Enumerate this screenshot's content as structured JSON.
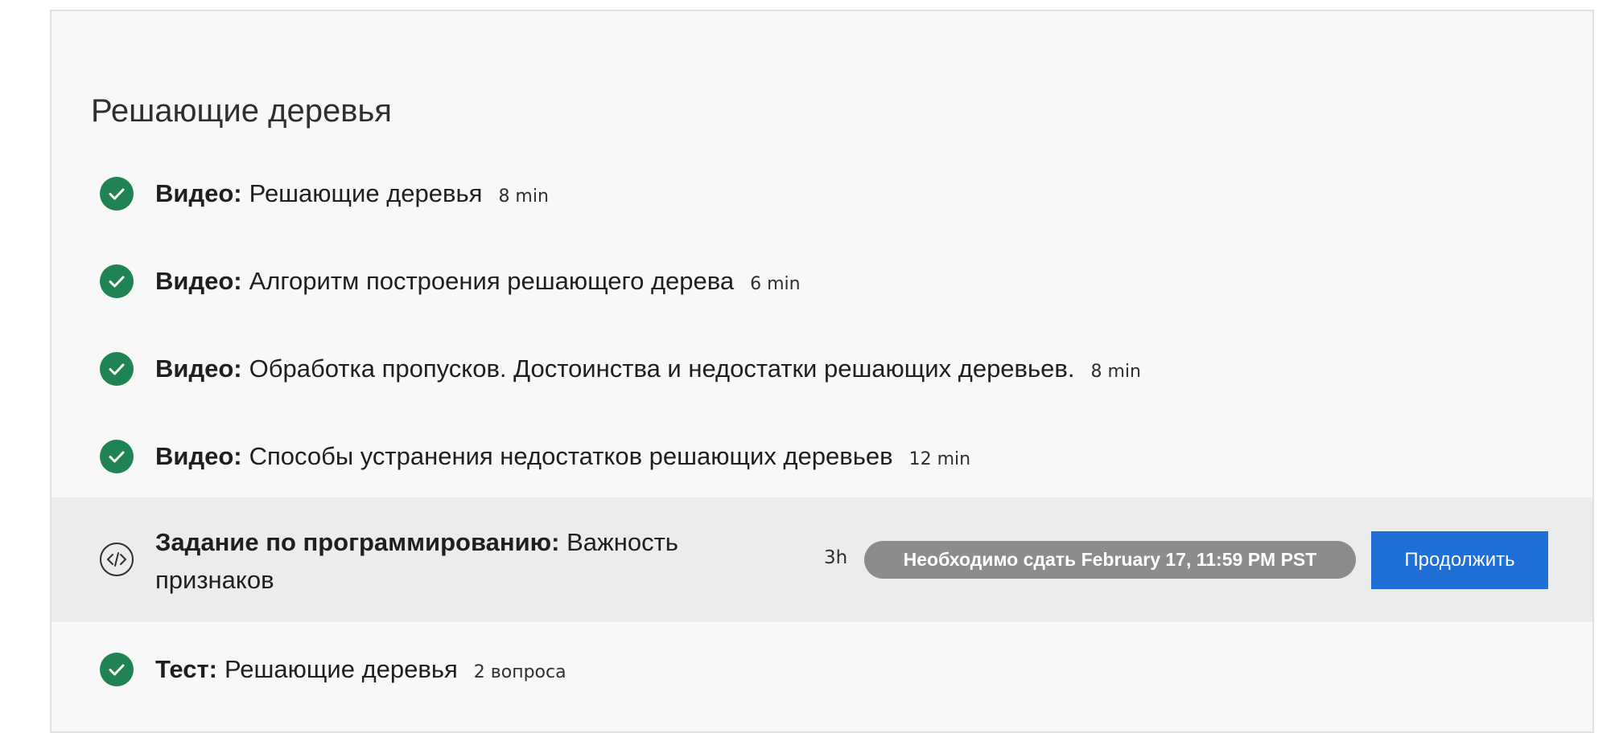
{
  "section": {
    "title": "Решающие деревья"
  },
  "items": [
    {
      "type": "Видео:",
      "title": "Решающие деревья",
      "duration": "8 min",
      "status": "completed",
      "icon": "check-icon"
    },
    {
      "type": "Видео:",
      "title": "Алгоритм построения решающего дерева",
      "duration": "6 min",
      "status": "completed",
      "icon": "check-icon"
    },
    {
      "type": "Видео:",
      "title": "Обработка пропусков. Достоинства и недостатки решающих деревьев.",
      "duration": "8 min",
      "status": "completed",
      "icon": "check-icon"
    },
    {
      "type": "Видео:",
      "title": "Способы устранения недостатков решающих деревьев",
      "duration": "12 min",
      "status": "completed",
      "icon": "check-icon"
    }
  ],
  "assignment": {
    "type": "Задание по программированию:",
    "title": "Важность признаков",
    "duration": "3h",
    "due_badge": "Необходимо сдать February 17, 11:59 PM PST",
    "button_label": "Продолжить",
    "icon": "code-icon"
  },
  "quiz": {
    "type": "Тест:",
    "title": "Решающие деревья",
    "duration": "2 вопроса",
    "status": "completed",
    "icon": "check-icon"
  },
  "colors": {
    "completed": "#1f8354",
    "button": "#1f6fd6",
    "badge": "#8c8c8c",
    "active_row": "#ececec",
    "panel": "#f8f8f8"
  }
}
